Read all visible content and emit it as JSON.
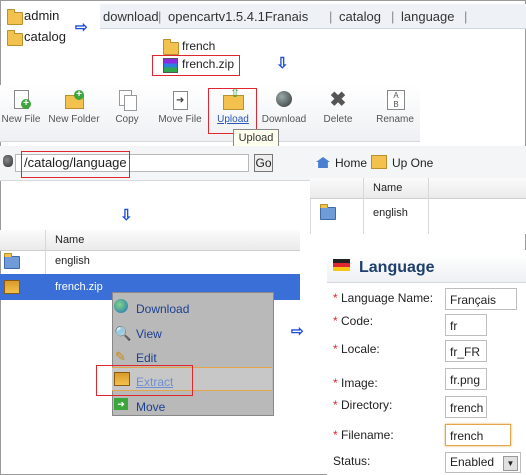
{
  "folders": {
    "admin": "admin",
    "catalog": "catalog"
  },
  "path_bar": [
    "download",
    "opencartv1.5.4.1Franais",
    "catalog",
    "language"
  ],
  "path_sep": "|",
  "files_top": {
    "folder": "french",
    "zip": "french.zip"
  },
  "toolbar": [
    {
      "label": "New File",
      "icon": "new-file-icon"
    },
    {
      "label": "New Folder",
      "icon": "new-folder-icon"
    },
    {
      "label": "Copy",
      "icon": "copy-icon"
    },
    {
      "label": "Move File",
      "icon": "move-file-icon"
    },
    {
      "label": "Upload",
      "icon": "upload-icon"
    },
    {
      "label": "Download",
      "icon": "download-icon"
    },
    {
      "label": "Delete",
      "icon": "delete-icon"
    },
    {
      "label": "Rename",
      "icon": "rename-icon"
    }
  ],
  "tooltip": "Upload",
  "path_input": "/catalog/language",
  "go_label": "Go",
  "nav": {
    "home": "Home",
    "up_one": "Up One"
  },
  "right_list": {
    "header": "Name",
    "item": "english"
  },
  "file_list": {
    "header": "Name",
    "items": [
      "english",
      "french.zip"
    ]
  },
  "context_menu": [
    "Download",
    "View",
    "Edit",
    "Extract",
    "Move"
  ],
  "language_form": {
    "title": "Language",
    "fields": [
      {
        "label": "Language Name:",
        "value": "Français",
        "required": true
      },
      {
        "label": "Code:",
        "value": "fr",
        "required": true
      },
      {
        "label": "Locale:",
        "value": "fr_FR",
        "required": true
      },
      {
        "label": "Image:",
        "value": "fr.png",
        "required": true
      },
      {
        "label": "Directory:",
        "value": "french",
        "required": true
      },
      {
        "label": "Filename:",
        "value": "french",
        "required": true
      },
      {
        "label": "Status:",
        "value": "Enabled",
        "required": false
      }
    ]
  },
  "colors": {
    "accent": "#3a6fd8",
    "required": "#e0262f",
    "selection": "#3a6fd8"
  }
}
